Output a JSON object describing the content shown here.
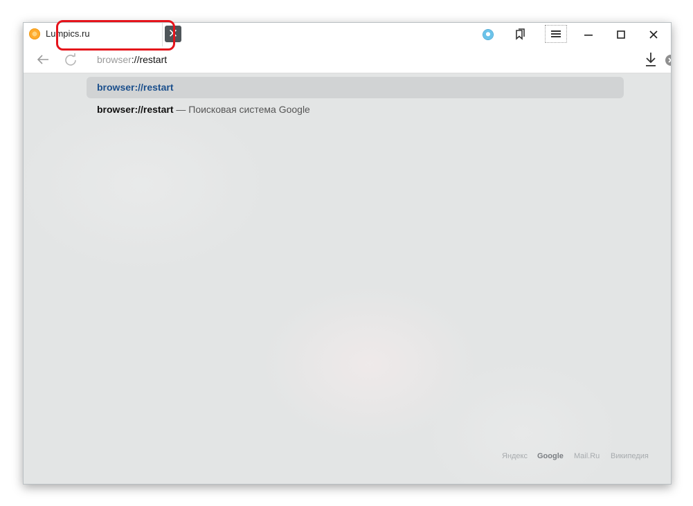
{
  "tab": {
    "title": "Lumpics.ru"
  },
  "omnibox": {
    "prefix_dim": "browser",
    "suffix": "://restart"
  },
  "suggestions": [
    {
      "url": "browser://restart"
    },
    {
      "query": "browser://restart",
      "desc": " — Поисковая система Google"
    }
  ],
  "footer": {
    "links": [
      "Яндекс",
      "Google",
      "Mail.Ru",
      "Википедия"
    ]
  },
  "colors": {
    "highlight": "#e5131b",
    "link": "#1b4f8c"
  }
}
